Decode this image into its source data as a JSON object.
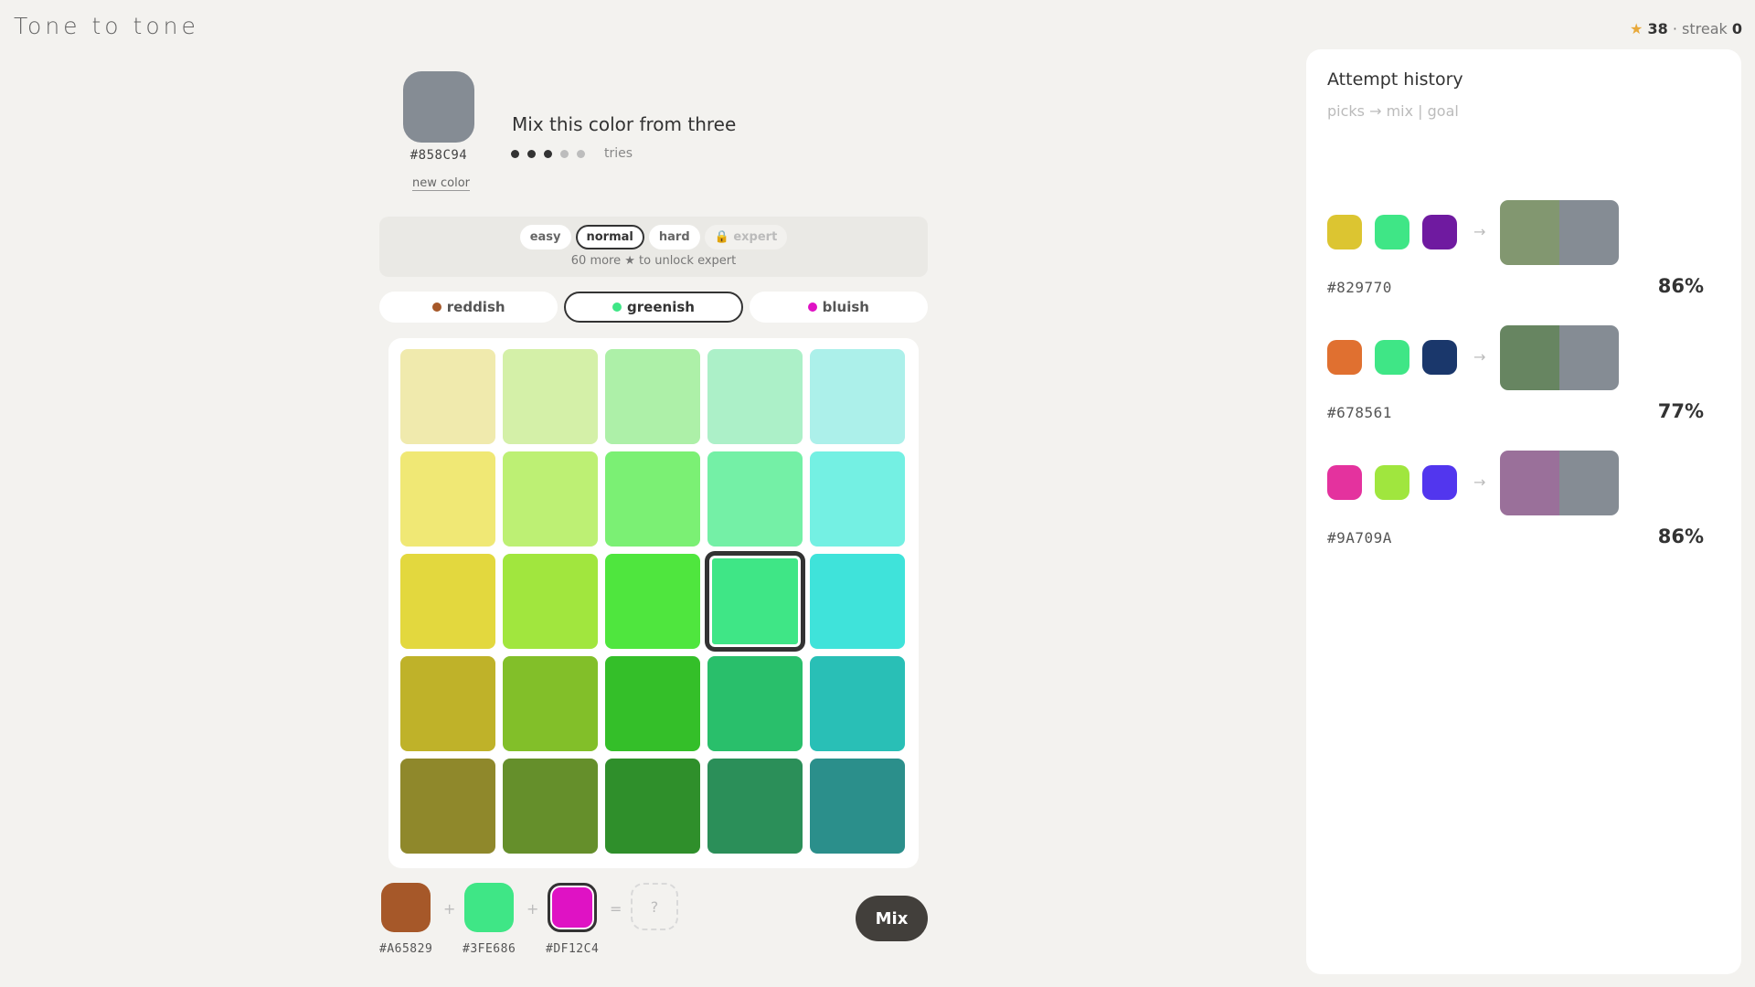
{
  "app": {
    "title": "Tone to tone"
  },
  "score": {
    "stars": "38",
    "sep": "· streak",
    "streak": "0",
    "star_glyph": "★"
  },
  "target": {
    "color": "#858C94",
    "hex": "#858C94",
    "new_color_label": "new color"
  },
  "prompt": {
    "text": "Mix this color from three",
    "tries_label": "tries",
    "tries_used": 3,
    "tries_total": 5
  },
  "difficulty": {
    "options": [
      {
        "label": "easy",
        "state": "normal"
      },
      {
        "label": "normal",
        "state": "active"
      },
      {
        "label": "hard",
        "state": "normal"
      },
      {
        "label": "🔒 expert",
        "state": "locked"
      }
    ],
    "note": "60 more ★ to unlock expert"
  },
  "families": [
    {
      "label": "reddish",
      "color": "#A65829",
      "active": false
    },
    {
      "label": "greenish",
      "color": "#3FE686",
      "active": true
    },
    {
      "label": "bluish",
      "color": "#DF12C4",
      "active": false
    }
  ],
  "grid": {
    "colors": [
      [
        "#F0EAAD",
        "#D4F0A8",
        "#ADF0A8",
        "#ACF0C8",
        "#ACF0EA"
      ],
      [
        "#F0E875",
        "#BDF074",
        "#7BF074",
        "#74F0A6",
        "#74F0E3"
      ],
      [
        "#E3D83E",
        "#A1E63E",
        "#4FE63E",
        "#3FE686",
        "#3FE3DA"
      ],
      [
        "#BFB229",
        "#82BF29",
        "#34BF29",
        "#29BF6B",
        "#29BFB6"
      ],
      [
        "#8F882B",
        "#658F2B",
        "#2F8F2B",
        "#2B8F59",
        "#2B8F8B"
      ]
    ],
    "selected": [
      2,
      3
    ]
  },
  "picks": [
    {
      "color": "#A65829",
      "hex": "#A65829"
    },
    {
      "color": "#3FE686",
      "hex": "#3FE686"
    },
    {
      "color": "#DF12C4",
      "hex": "#DF12C4"
    }
  ],
  "operators": {
    "plus": "+",
    "equals": "=",
    "result_placeholder": "?"
  },
  "mix_label": "Mix",
  "history": {
    "title": "Attempt history",
    "subtitle": "picks → mix | goal",
    "arrow": "→",
    "attempts": [
      {
        "picks": [
          "#DCC531",
          "#3FE686",
          "#6F1AA0"
        ],
        "mix": "#829770",
        "goal": "#858C94",
        "hex": "#829770",
        "score": "86%"
      },
      {
        "picks": [
          "#E07030",
          "#3FE686",
          "#1A376B"
        ],
        "mix": "#678561",
        "goal": "#858C94",
        "hex": "#678561",
        "score": "77%"
      },
      {
        "picks": [
          "#E4329E",
          "#A0E63E",
          "#5236EE"
        ],
        "mix": "#9A709A",
        "goal": "#858C94",
        "hex": "#9A709A",
        "score": "86%"
      }
    ]
  }
}
